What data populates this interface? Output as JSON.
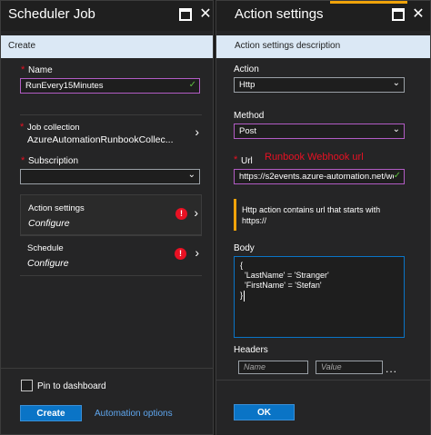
{
  "left_blade": {
    "title": "Scheduler Job",
    "subbar_label": "Create",
    "name": {
      "label": "Name",
      "required_mark": "*",
      "value": "RunEvery15Minutes"
    },
    "job_collection": {
      "label": "Job collection",
      "required_mark": "*",
      "value": "AzureAutomationRunbookCollec..."
    },
    "subscription": {
      "label": "Subscription",
      "required_mark": "*",
      "value": ""
    },
    "action_settings": {
      "title": "Action settings",
      "subtitle": "Configure",
      "error_mark": "!"
    },
    "schedule": {
      "title": "Schedule",
      "subtitle": "Configure",
      "error_mark": "!"
    },
    "pin_label": "Pin to dashboard",
    "create_label": "Create",
    "automation_options_label": "Automation options"
  },
  "right_blade": {
    "title": "Action settings",
    "subbar_label": "Action settings description",
    "action": {
      "label": "Action",
      "value": "Http"
    },
    "method": {
      "label": "Method",
      "value": "Post"
    },
    "url": {
      "label": "Url",
      "required_mark": "*",
      "value": "https://s2events.azure-automation.net/we"
    },
    "annotation": "Runbook Webhook url",
    "info_text": "Http action contains url that starts with https://",
    "body": {
      "label": "Body",
      "lines": [
        "{",
        "  'LastName' = 'Stranger'",
        "  'FirstName' = 'Stefan'",
        "}"
      ]
    },
    "headers": {
      "label": "Headers",
      "name_placeholder": "Name",
      "value_placeholder": "Value"
    },
    "more_label": "...",
    "ok_label": "OK"
  },
  "icons": {
    "maximize": "maximize-icon",
    "close": "close-icon",
    "check": "check-icon",
    "chevron_down": "chevron-down-icon",
    "chevron_right": "chevron-right-icon",
    "error": "error-icon",
    "close_glyph": "✕",
    "check_glyph": "✓",
    "chevron_down_glyph": "⌄",
    "chevron_right_glyph": "›"
  },
  "colors": {
    "accent_blue": "#0a74c6",
    "subbar": "#dbe8f5",
    "focus_purple": "#b25cc4",
    "error_red": "#e81123",
    "warning_orange": "#f0a30a",
    "valid_green": "#5fbf3f"
  }
}
